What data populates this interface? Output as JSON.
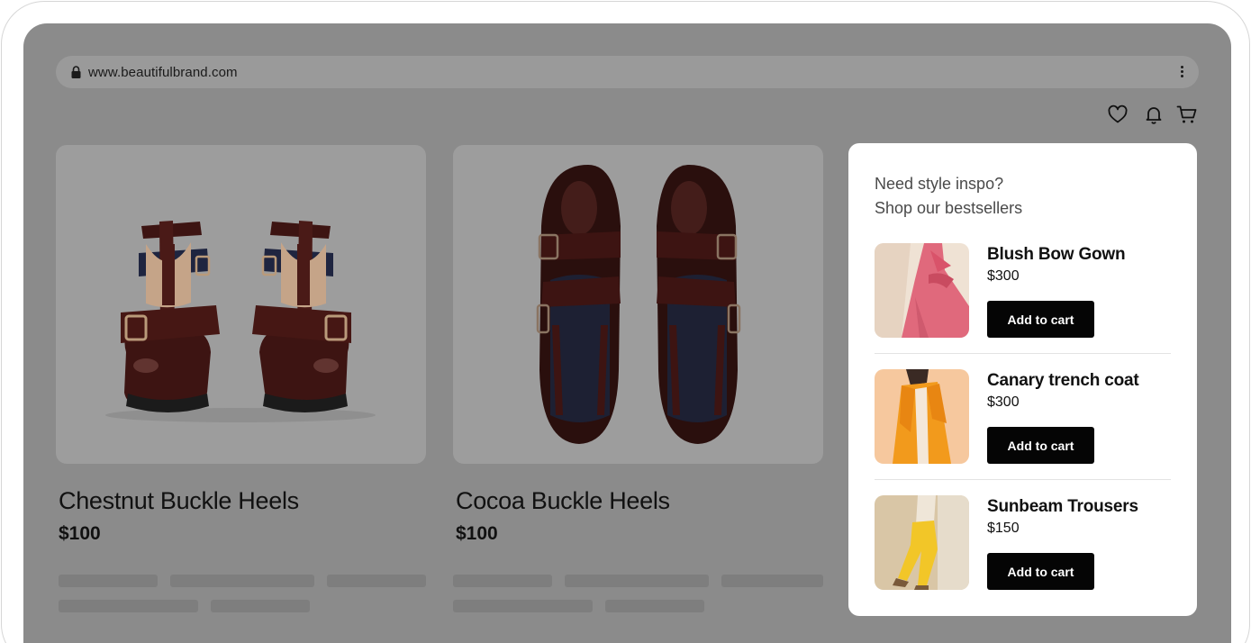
{
  "browser": {
    "url": "www.beautifulbrand.com",
    "icons": [
      "lock-icon",
      "kebab-menu-icon"
    ]
  },
  "header": {
    "icons": [
      "heart-icon",
      "bell-icon",
      "cart-icon"
    ]
  },
  "products": [
    {
      "name": "Chestnut Buckle Heels",
      "price": "$100",
      "image": "pair of glossy chestnut leather buckle heels, front view"
    },
    {
      "name": "Cocoa Buckle Heels",
      "price": "$100",
      "image": "pair of dark cocoa leather buckle heels, top view"
    }
  ],
  "popup": {
    "title_line1": "Need style inspo?",
    "title_line2": "Shop our bestsellers",
    "items": [
      {
        "name": "Blush Bow Gown",
        "price": "$300",
        "button": "Add to cart"
      },
      {
        "name": "Canary trench coat",
        "price": "$300",
        "button": "Add to cart"
      },
      {
        "name": "Sunbeam Trousers",
        "price": "$150",
        "button": "Add to cart"
      }
    ]
  },
  "colors": {
    "overlay": "#8b8b8b",
    "popup_bg": "#ffffff",
    "button_bg": "#050505",
    "shoe_leather": "#3d1412"
  }
}
